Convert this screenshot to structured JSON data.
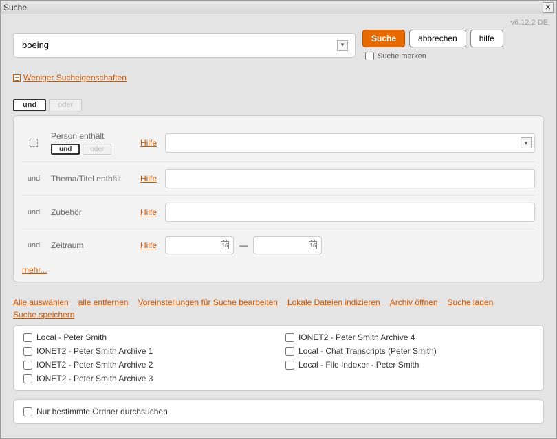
{
  "window": {
    "title": "Suche"
  },
  "meta": {
    "version": "v6.12.2  DE"
  },
  "search": {
    "query": "boeing",
    "submit": "Suche",
    "cancel": "abbrechen",
    "help": "hilfe",
    "remember": "Suche merken",
    "toggleLabel": "Weniger Sucheigenschaften"
  },
  "logic": {
    "and": "und",
    "or": "oder"
  },
  "criteria": {
    "rows": [
      {
        "prefixType": "firstBlock",
        "label": "Person enthält"
      },
      {
        "prefix": "und",
        "label": "Thema/Titel enthält"
      },
      {
        "prefix": "und",
        "label": "Zubehör"
      },
      {
        "prefix": "und",
        "label": "Zeitraum"
      }
    ],
    "hilfe": "Hilfe",
    "more": "mehr..."
  },
  "date": {
    "calNum": "16",
    "sep": "—"
  },
  "actions": {
    "selectAll": "Alle auswählen",
    "removeAll": "alle entfernen",
    "editDefaults": "Voreinstellungen für Suche bearbeiten",
    "indexLocal": "Lokale Dateien indizieren",
    "openArchive": "Archiv öffnen",
    "loadSearch": "Suche laden",
    "saveSearch": "Suche speichern"
  },
  "sources": [
    "Local - Peter Smith",
    "IONET2 - Peter Smith Archive 4",
    "IONET2 - Peter Smith Archive 1",
    "Local - Chat Transcripts (Peter Smith)",
    "IONET2 - Peter Smith Archive 2",
    "Local - File Indexer - Peter Smith",
    "IONET2 - Peter Smith Archive 3"
  ],
  "folders": {
    "onlySpecific": "Nur bestimmte Ordner durchsuchen"
  }
}
